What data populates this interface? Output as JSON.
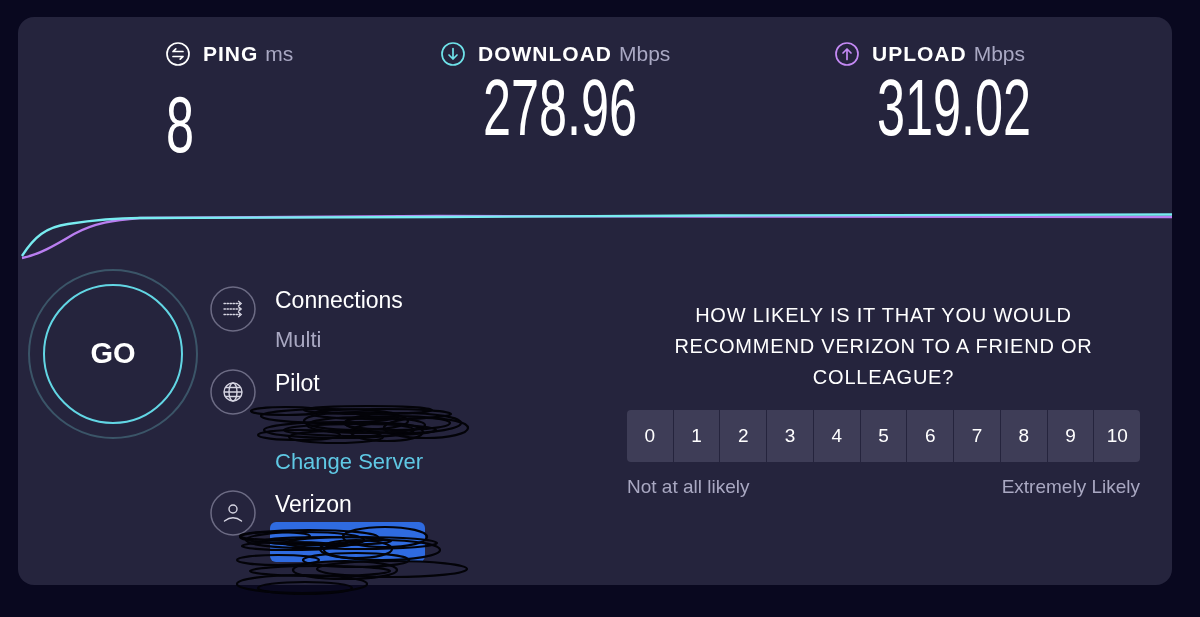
{
  "metrics": [
    {
      "kind": "ping",
      "label": "PING",
      "unit": "ms",
      "value": "8",
      "color": "#ffffff"
    },
    {
      "kind": "download",
      "label": "DOWNLOAD",
      "unit": "Mbps",
      "value": "278.96",
      "color": "#6fe3ea"
    },
    {
      "kind": "upload",
      "label": "UPLOAD",
      "unit": "Mbps",
      "value": "319.02",
      "color": "#c58af5"
    }
  ],
  "go_button": {
    "label": "GO"
  },
  "info_rows": [
    {
      "kind": "connections",
      "title": "Connections",
      "value": "Multi"
    },
    {
      "kind": "server",
      "title": "Pilot",
      "redacted": true,
      "link": "Change Server"
    },
    {
      "kind": "provider",
      "title": "Verizon",
      "redacted": true
    }
  ],
  "survey": {
    "question": "HOW LIKELY IS IT THAT YOU WOULD RECOMMEND VERIZON TO A FRIEND OR COLLEAGUE?",
    "scale": [
      "0",
      "1",
      "2",
      "3",
      "4",
      "5",
      "6",
      "7",
      "8",
      "9",
      "10"
    ],
    "low_label": "Not at all likely",
    "high_label": "Extremely Likely"
  }
}
